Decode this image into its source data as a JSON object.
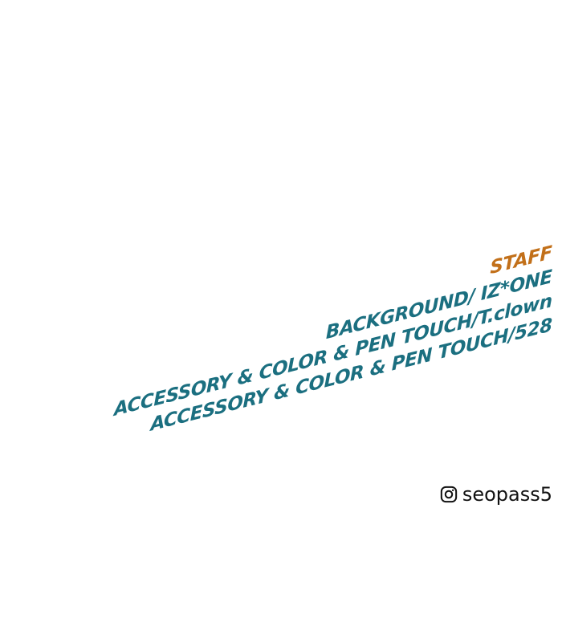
{
  "credits": {
    "title": "STAFF",
    "lines": [
      "BACKGROUND/ IZ*ONE",
      "ACCESSORY & COLOR & PEN TOUCH/T.clown",
      "ACCESSORY & COLOR & PEN TOUCH/528"
    ],
    "colors": {
      "title": "#c2701a",
      "lines": "#1b6f80"
    }
  },
  "social": {
    "icon": "instagram-icon",
    "handle": "seopass5"
  }
}
